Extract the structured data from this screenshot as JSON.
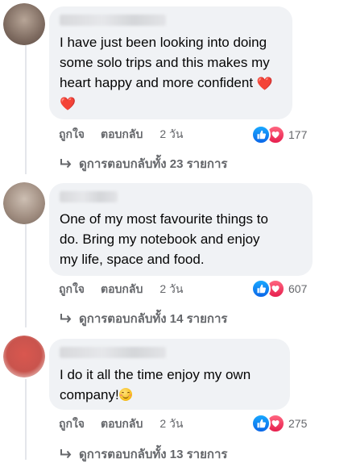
{
  "comments": [
    {
      "text": "I have just been looking into doing\nsome solo trips and this makes my\nheart happy and more confident ",
      "end_emoji": "heart",
      "second_heart": true,
      "actions": {
        "like": "ถูกใจ",
        "reply": "ตอบกลับ",
        "time": "2 วัน"
      },
      "reaction_count": "177",
      "replies_link": "ดูการตอบกลับทั้ง 23 รายการ",
      "avatar_color": "#8c7a6e"
    },
    {
      "text": "One of my most favourite things to\ndo. Bring my notebook and enjoy\nmy life, space and food.",
      "actions": {
        "like": "ถูกใจ",
        "reply": "ตอบกลับ",
        "time": "2 วัน"
      },
      "reaction_count": "607",
      "replies_link": "ดูการตอบกลับทั้ง 14 รายการ",
      "avatar_color": "#a89789"
    },
    {
      "text": "I do it all the time enjoy my own\ncompany!",
      "end_emoji": "smiling-face",
      "actions": {
        "like": "ถูกใจ",
        "reply": "ตอบกลับ",
        "time": "2 วัน"
      },
      "reaction_count": "275",
      "replies_link": "ดูการตอบกลับทั้ง 13 รายการ",
      "avatar_color": "#c9544d"
    }
  ],
  "colors": {
    "bubble_bg": "#f0f2f5",
    "secondary_text": "#65676b",
    "like_blue": "#1877f2",
    "love_red": "#f33e58"
  }
}
